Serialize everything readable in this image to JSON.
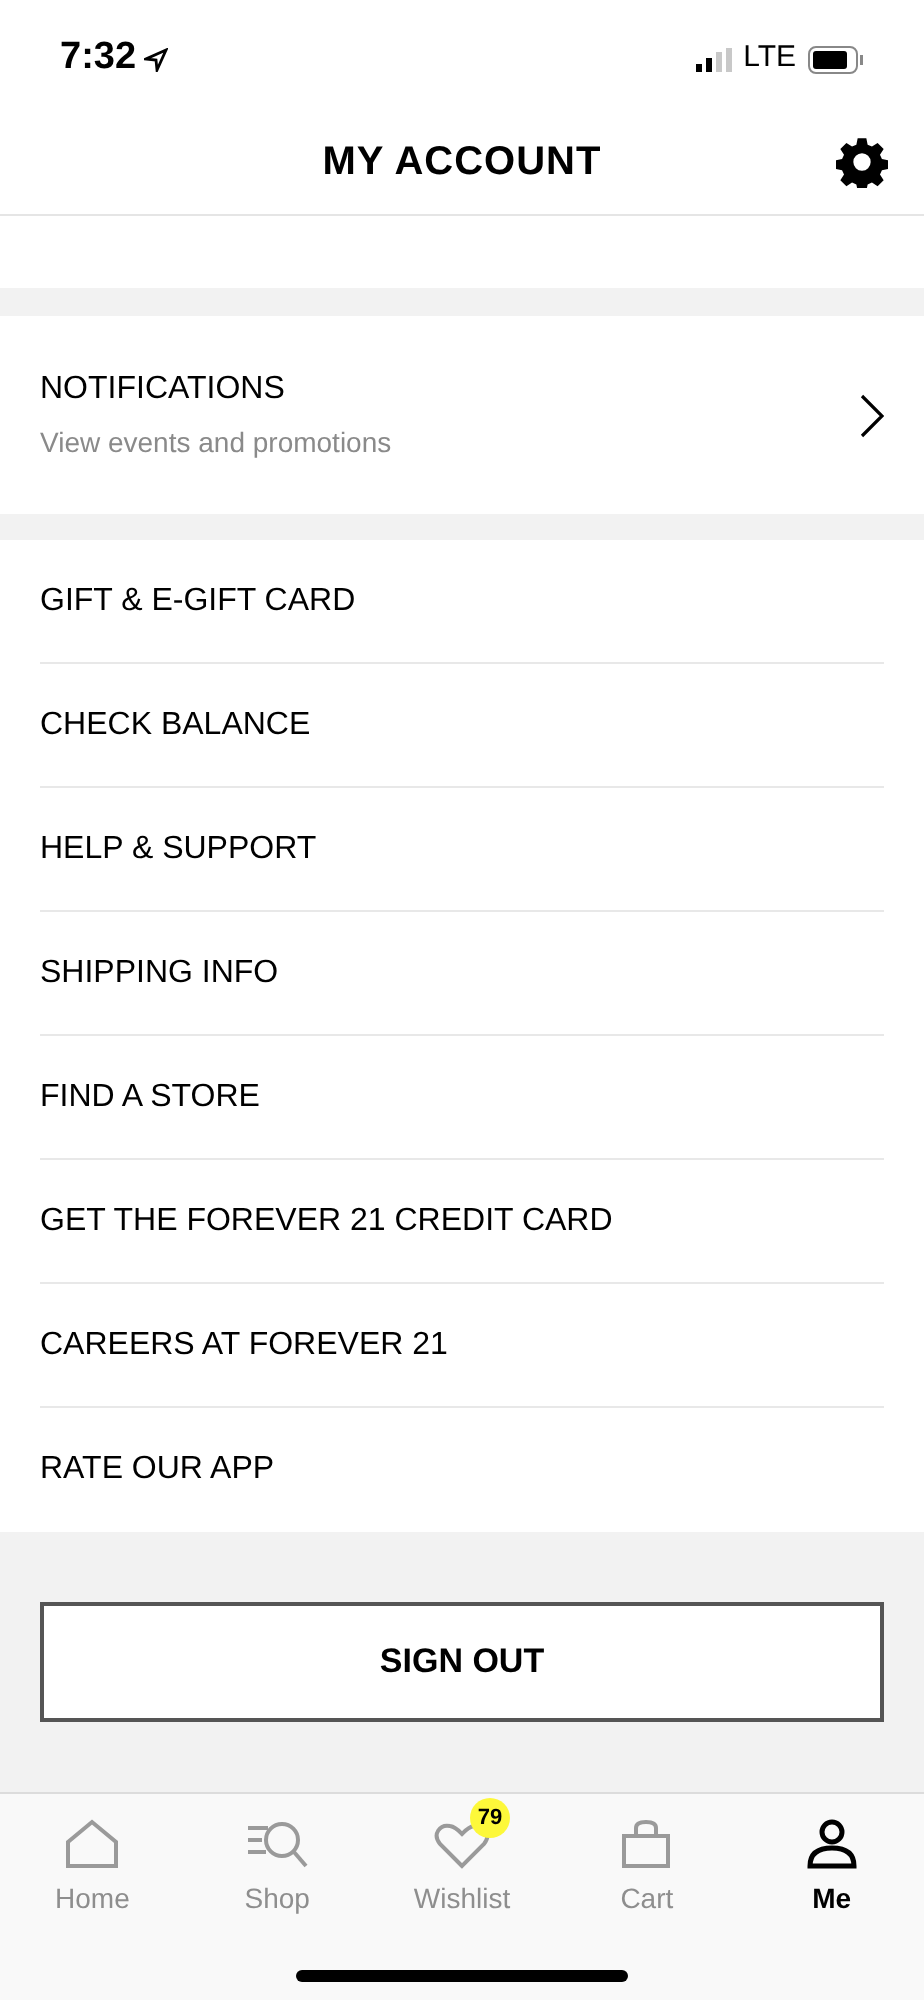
{
  "status_bar": {
    "time": "7:32",
    "network": "LTE"
  },
  "header": {
    "title": "MY ACCOUNT"
  },
  "notifications": {
    "title": "NOTIFICATIONS",
    "subtitle": "View events and promotions"
  },
  "menu_items": [
    "GIFT & E-GIFT CARD",
    "CHECK BALANCE",
    "HELP & SUPPORT",
    "SHIPPING INFO",
    "FIND A STORE",
    "GET THE FOREVER 21 CREDIT CARD",
    "CAREERS AT FOREVER 21",
    "RATE OUR APP"
  ],
  "sign_out": "SIGN OUT",
  "tabs": [
    {
      "kind": "home",
      "label": "Home",
      "selected": false
    },
    {
      "kind": "shop",
      "label": "Shop",
      "selected": false
    },
    {
      "kind": "wishlist",
      "label": "Wishlist",
      "selected": false,
      "badge": "79"
    },
    {
      "kind": "cart",
      "label": "Cart",
      "selected": false
    },
    {
      "kind": "me",
      "label": "Me",
      "selected": true
    }
  ]
}
